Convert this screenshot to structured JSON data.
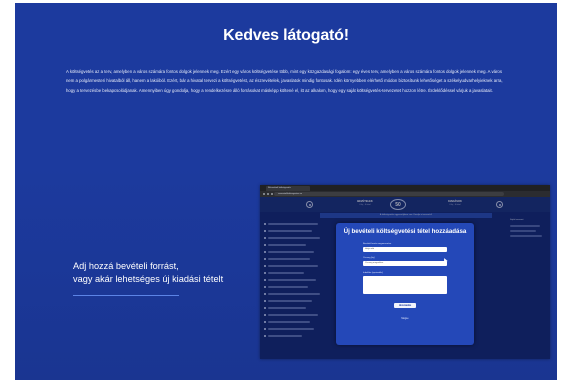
{
  "page": {
    "title": "Kedves látogató!",
    "intro": "A költségvetés az a terv, amelyben a város számára fontos dolgok jelennek meg. Ezért egy város költségvetése több, mint egy közgazdasági fogalom: egy éves terv, amelyben a város számára fontos dolgok jelennek meg. A város nem a polgármesteri hivatalból áll, hanem a lakóiból. Ezért, bár a hivatal tervezi a költségvetést, az észrevételek, javaslatok mindig fontosak. Idén környebben elérhető módon biztosítunk lehetőséget a székelyudvarhelyieknek arra, hogy a tervezésbe bekapcsolódjanak. Amennyiben úgy gondolja, hogy a rendelkezésre álló forrásokat másképp költené el, itt az alkalom, hogy egy saját költségvetés-tervezetet hozzon létre. Érdeklődéssel várjuk a javaslatait.",
    "cta_line1": "Adj hozzá bevételi forrást,",
    "cta_line2": "vagy akár lehetséges új kiadási tételt"
  },
  "screenshot": {
    "browser_tab": "Részvételi költségvetés",
    "address": "reszvetelikoltsegvetes.ro",
    "stat_left_label": "BEVÉTELEK",
    "stat_left_sub": "0 lej · 0 tétel",
    "stat_right_label": "KIADÁSOK",
    "stat_right_sub": "0 lej · 0 tétel",
    "center_number": "50",
    "info_strip": "A költségvetés egyensúlyban van. Kezdje a tervezést!",
    "right_panel_head": "Saját tervezet",
    "modal": {
      "title": "Új bevételi költségvetési tétel hozzáadása",
      "field1_label": "Bevételi forrás megnevezése",
      "field1_value": "Helyi adó",
      "field2_label": "Összeg (lej)",
      "field2_value": "Összeg megadása",
      "field3_label": "Indoklás (opcionális)",
      "submit": "Hozzáadás",
      "cancel": "Mégse"
    }
  },
  "colors": {
    "background": "#1c3a9e",
    "accent_line": "#5c84e6",
    "modal": "#2448b8"
  }
}
